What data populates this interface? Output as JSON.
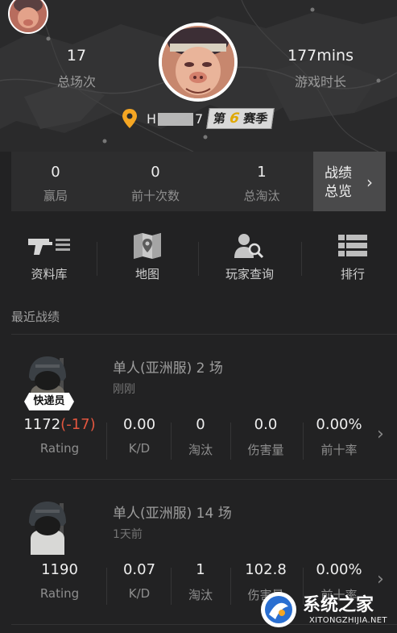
{
  "header": {
    "total_matches": {
      "value": "17",
      "label": "总场次"
    },
    "play_time": {
      "value": "177mins",
      "label": "游戏时长"
    },
    "username": "H",
    "username_tail": "7",
    "season": {
      "prefix": "第",
      "number": "6",
      "suffix": "赛季"
    }
  },
  "summary": {
    "wins": {
      "value": "0",
      "label": "赢局"
    },
    "top10": {
      "value": "0",
      "label": "前十次数"
    },
    "kills": {
      "value": "1",
      "label": "总淘汰"
    },
    "overview_label": "战绩总览"
  },
  "menu": [
    {
      "label": "资料库",
      "icon": "gun-icon"
    },
    {
      "label": "地图",
      "icon": "map-icon"
    },
    {
      "label": "玩家查询",
      "icon": "player-search-icon"
    },
    {
      "label": "排行",
      "icon": "ranking-icon"
    }
  ],
  "recent_title": "最近战绩",
  "matches": [
    {
      "title": "单人(亚洲服) 2 场",
      "time": "刚刚",
      "badge": "快递员",
      "rating": "1172",
      "rating_change": "(-17)",
      "stats": [
        {
          "value": "0.00",
          "label": "K/D"
        },
        {
          "value": "0",
          "label": "淘汰"
        },
        {
          "value": "0.0",
          "label": "伤害量"
        },
        {
          "value": "0.00%",
          "label": "前十率"
        }
      ],
      "rating_label": "Rating"
    },
    {
      "title": "单人(亚洲服) 14 场",
      "time": "1天前",
      "rating": "1190",
      "stats": [
        {
          "value": "0.07",
          "label": "K/D"
        },
        {
          "value": "1",
          "label": "淘汰"
        },
        {
          "value": "102.8",
          "label": "伤害量"
        },
        {
          "value": "0.00%",
          "label": "前十率"
        }
      ],
      "rating_label": "Rating"
    }
  ],
  "watermark": {
    "title": "系统之家",
    "url": "XITONGZHIJIA.NET"
  },
  "colors": {
    "accent_negative": "#e3563f",
    "pin": "#f5a623",
    "season_number": "#e0a800"
  }
}
